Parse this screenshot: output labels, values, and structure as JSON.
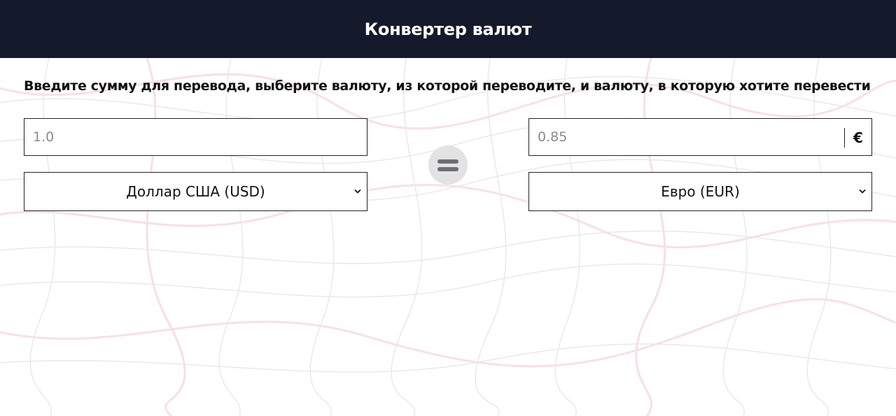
{
  "header": {
    "title": "Конвертер валют",
    "background": "#141a2b"
  },
  "instruction": "Введите сумму для перевода, выберите валюту, из которой переводите, и валюту, в которую хотите перевести",
  "from": {
    "amount_placeholder": "1.0",
    "currency_selected": "Доллар США (USD)"
  },
  "to": {
    "amount_placeholder": "0.85",
    "currency_symbol": "€",
    "currency_selected": "Евро (EUR)"
  },
  "swap_button": {
    "icon": "equals-icon"
  },
  "background_pattern": {
    "line_color": "#f4c6d0"
  }
}
